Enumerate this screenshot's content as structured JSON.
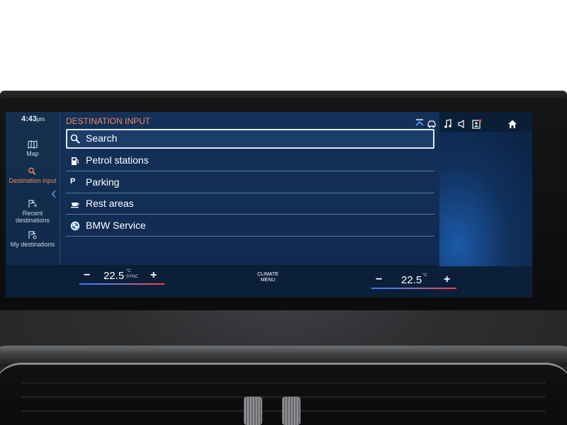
{
  "clock": {
    "time": "4:43",
    "ampm": "pm"
  },
  "sidebar": {
    "items": [
      {
        "label": "Map",
        "icon": "map-icon"
      },
      {
        "label": "Destination input",
        "icon": "search-icon",
        "active": true
      },
      {
        "label": "Recent destinations",
        "icon": "recent-destinations-icon"
      },
      {
        "label": "My destinations",
        "icon": "my-destinations-icon"
      }
    ]
  },
  "main": {
    "title": "DESTINATION INPUT",
    "items": [
      {
        "label": "Search",
        "icon": "search-icon",
        "selected": true
      },
      {
        "label": "Petrol stations",
        "icon": "fuel-pump-icon"
      },
      {
        "label": "Parking",
        "icon": "parking-icon",
        "glyph": "P"
      },
      {
        "label": "Rest areas",
        "icon": "cup-icon"
      },
      {
        "label": "BMW Service",
        "icon": "bmw-logo-icon"
      }
    ]
  },
  "status_bar": {
    "icons": [
      "widgets-icon",
      "car-icon",
      "music-icon",
      "volume-icon",
      "notification-icon",
      "home-icon"
    ]
  },
  "climate": {
    "left": {
      "minus": "−",
      "value": "22.5",
      "unit": "°C",
      "sync": "SYNC",
      "plus": "+"
    },
    "menu_line1": "CLIMATE",
    "menu_line2": "MENU",
    "right": {
      "minus": "−",
      "value": "22.5",
      "unit": "°C",
      "plus": "+"
    }
  },
  "colors": {
    "accent_orange": "#f2855a",
    "screen_bg": "#133159",
    "temp_cold": "#2a7fff",
    "temp_hot": "#ff3a3a"
  }
}
